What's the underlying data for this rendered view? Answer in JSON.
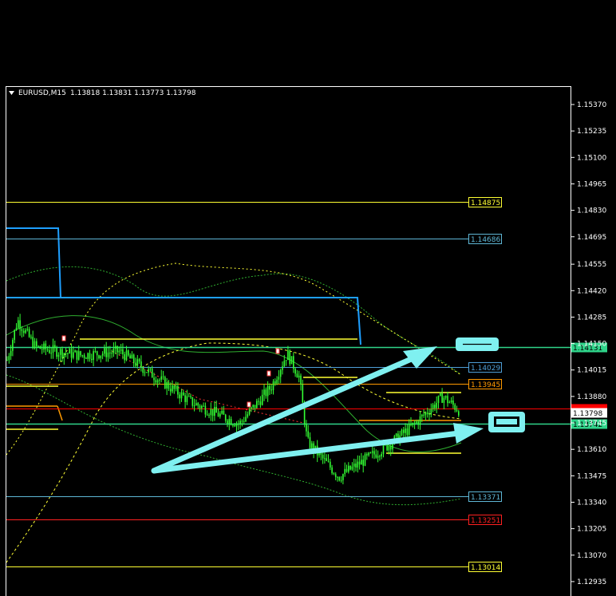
{
  "header": {
    "symbol": "EURUSD,M15",
    "ohlc": "1.13818 1.13831 1.13773 1.13798"
  },
  "chart_data": {
    "type": "candlestick",
    "symbol": "EURUSD",
    "timeframe": "M15",
    "ohlc": {
      "open": 1.13818,
      "high": 1.13831,
      "low": 1.13773,
      "close": 1.13798
    },
    "ylim": [
      1.1287,
      1.1547
    ],
    "y_ticks": [
      "1.15370",
      "1.15235",
      "1.15100",
      "1.14965",
      "1.14830",
      "1.14695",
      "1.14555",
      "1.14420",
      "1.14285",
      "1.14150",
      "1.14015",
      "1.13880",
      "1.13745",
      "1.13610",
      "1.13475",
      "1.13340",
      "1.13205",
      "1.13070",
      "1.12935"
    ],
    "current_price": {
      "value": 1.13798,
      "label": "1.13798"
    },
    "price_markers": [
      {
        "value": 1.14131,
        "label": "1.14131",
        "color": "#2fd48a"
      },
      {
        "value": 1.13742,
        "label": "1.13742",
        "color": "#2fd48a"
      },
      {
        "value": 1.13818,
        "label": "",
        "color": "#ff0000"
      }
    ],
    "levels": [
      {
        "value": 1.14875,
        "label": "1.14875",
        "color": "#ffff33"
      },
      {
        "value": 1.14686,
        "label": "1.14686",
        "color": "#5fb7d6"
      },
      {
        "value": 1.14029,
        "label": "1.14029",
        "color": "#4f9fd8"
      },
      {
        "value": 1.13945,
        "label": "1.13945",
        "color": "#ff9900"
      },
      {
        "value": 1.13371,
        "label": "1.13371",
        "color": "#5fb7d6"
      },
      {
        "value": 1.13251,
        "label": "1.13251",
        "color": "#ff2020"
      },
      {
        "value": 1.13014,
        "label": "1.13014",
        "color": "#ffff33"
      }
    ],
    "candle_color": "#33ff33",
    "colors": {
      "background": "#000000",
      "arrow": "#7ff0f0",
      "grid_axis": "#ffffff"
    }
  }
}
